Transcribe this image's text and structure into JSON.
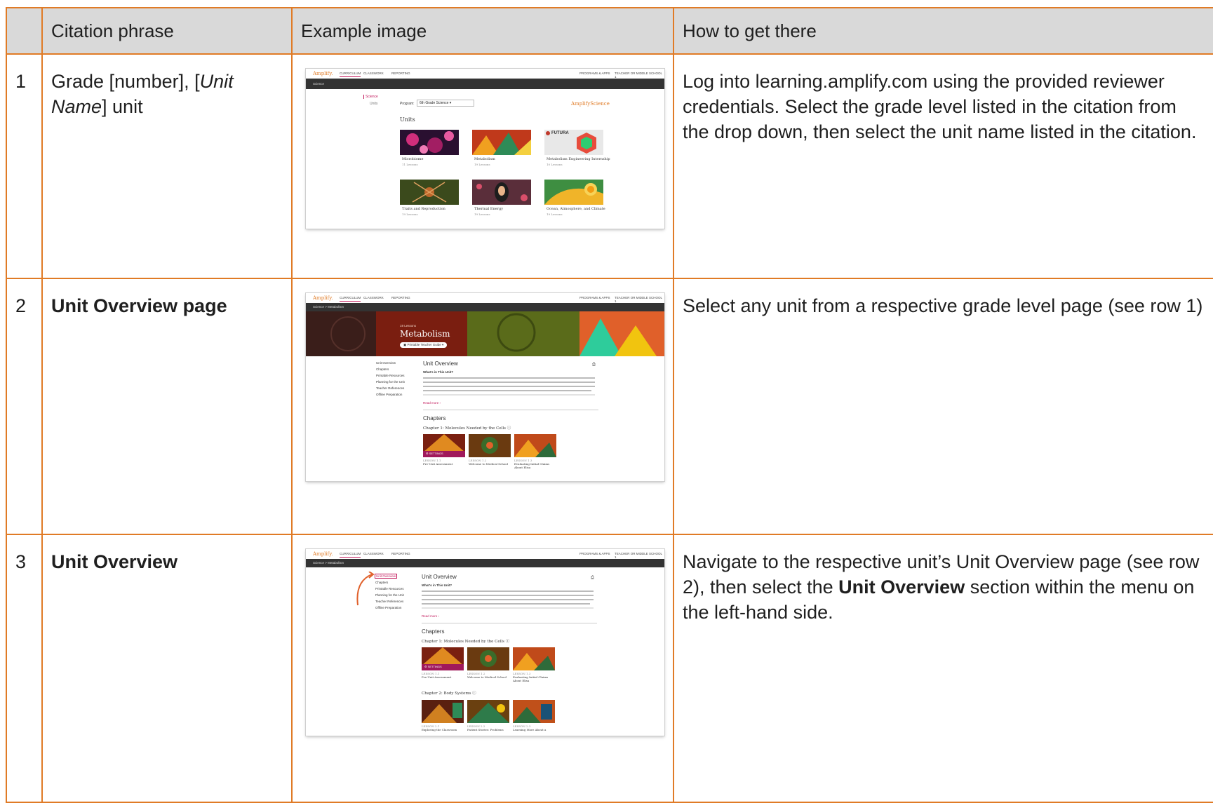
{
  "headers": [
    "",
    "Citation phrase",
    "Example image",
    "How to get there"
  ],
  "rows": [
    {
      "num": "1",
      "citation_pre": "Grade [number], [",
      "citation_em": "Unit Name",
      "citation_post": "] unit",
      "how": "Log into learning.amplify.com using the provided reviewer credentials. Select the grade level listed in the citation from the drop down, then select the unit name listed in the citation.",
      "shot": {
        "logo": "Amplify.",
        "nav": [
          "CURRICULUM",
          "CLASSWORK",
          "REPORTING"
        ],
        "right": [
          "PROGRAMS & APPS",
          "TEACHER OR MIDDLE SCHOOL 1"
        ],
        "crumb": "Science",
        "side": [
          "Science",
          "Units"
        ],
        "program_label": "Program:",
        "program_value": "6th Grade Science",
        "brand": "AmplifyScience",
        "units_heading": "Units",
        "units": [
          {
            "name": "Microbiome",
            "lessons": "11 Lessons"
          },
          {
            "name": "Metabolism",
            "lessons": "19 Lessons"
          },
          {
            "name": "Metabolism Engineering Internship",
            "lessons": "10 Lessons"
          },
          {
            "name": "Traits and Reproduction",
            "lessons": "19 Lessons"
          },
          {
            "name": "Thermal Energy",
            "lessons": "19 Lessons"
          },
          {
            "name": "Ocean, Atmosphere, and Climate",
            "lessons": "19 Lessons"
          }
        ],
        "futura": "FUTURA"
      }
    },
    {
      "num": "2",
      "citation": "Unit Overview page",
      "how": "Select any unit from a respective grade level page (see row 1)",
      "shot": {
        "crumb": "Science  >  Metabolism",
        "hero_lessons": "19 Lessons",
        "hero_title": "Metabolism",
        "hero_button": "Printable Teacher Guide",
        "menu": [
          "Unit Overview",
          "Chapters",
          "Printable Resources",
          "Planning for the Unit",
          "Teacher References",
          "Offline Preparation"
        ],
        "section": "Unit Overview",
        "subhead": "What's in This Unit?",
        "readmore": "Read more",
        "chapters": "Chapters",
        "chapter1": "Chapter 1: Molecules Needed by the Cells",
        "settings": "SETTINGS",
        "lessons": [
          {
            "num": "LESSON 1.1",
            "name": "Pre-Unit Assessment"
          },
          {
            "num": "LESSON 1.2",
            "name": "Welcome to Medical School"
          },
          {
            "num": "LESSON 1.3",
            "name": "Evaluating Initial Claims About Elisa"
          }
        ]
      }
    },
    {
      "num": "3",
      "citation": "Unit Overview",
      "how_pre": "Navigate to the respective unit’s Unit Overview page (see row 2), then select the ",
      "how_bold": "Unit Overview",
      "how_post": " section within the menu on the left-hand side.",
      "shot": {
        "chapter2": "Chapter 2: Body Systems",
        "lessons2": [
          {
            "num": "LESSON 2.1",
            "name": "Exploring the Classroom"
          },
          {
            "num": "LESSON 2.2",
            "name": "Patient Stories: Problems"
          },
          {
            "num": "LESSON 2.3",
            "name": "Learning More About a"
          }
        ]
      }
    }
  ],
  "colors": {
    "border": "#e07b26",
    "header_bg": "#d9d9d9",
    "accent": "#c2185b"
  }
}
